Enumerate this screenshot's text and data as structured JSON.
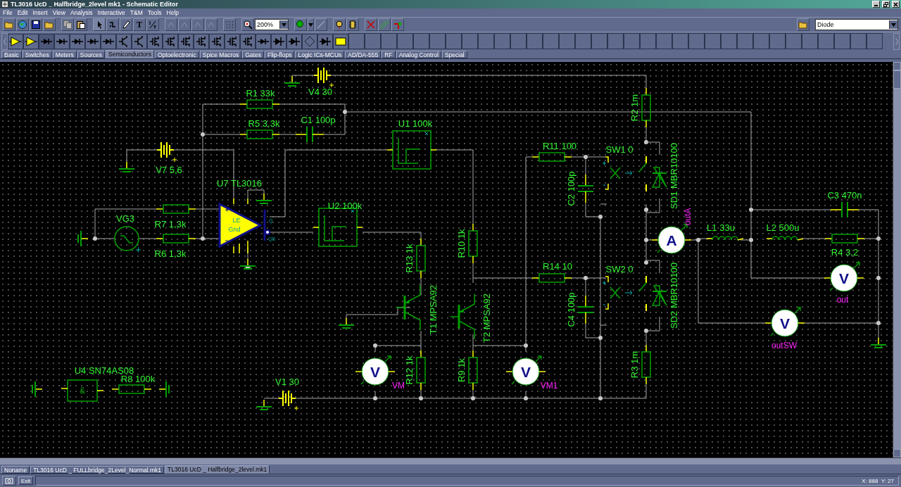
{
  "window": {
    "title": "TL3016 UcD _ Halfbridge_2level mk1 - Schematic Editor"
  },
  "menu": [
    "File",
    "Edit",
    "Insert",
    "View",
    "Analysis",
    "Interactive",
    "T&M",
    "Tools",
    "Help"
  ],
  "toolbar": {
    "text_tool": "T",
    "zoom": "200%",
    "component_select": "Diode"
  },
  "component_tabs": [
    {
      "label": "Basic",
      "selected": false
    },
    {
      "label": "Switches",
      "selected": false
    },
    {
      "label": "Meters",
      "selected": false
    },
    {
      "label": "Sources",
      "selected": false
    },
    {
      "label": "Semiconductors",
      "selected": true
    },
    {
      "label": "Optoelectronic",
      "selected": false
    },
    {
      "label": "Spice Macros",
      "selected": false
    },
    {
      "label": "Gates",
      "selected": false
    },
    {
      "label": "Flip-flops",
      "selected": false
    },
    {
      "label": "Logic ICs-MCUs",
      "selected": false
    },
    {
      "label": "AD/DA-555",
      "selected": false
    },
    {
      "label": "RF",
      "selected": false
    },
    {
      "label": "Analog Control",
      "selected": false
    },
    {
      "label": "Special",
      "selected": false
    }
  ],
  "schematic": {
    "parts": [
      {
        "kind": "resistor",
        "label": "R1 33k"
      },
      {
        "kind": "resistor",
        "label": "R5 3,3k"
      },
      {
        "kind": "capacitor",
        "label": "C1 100p"
      },
      {
        "kind": "battery",
        "label": "V4 30"
      },
      {
        "kind": "battery",
        "label": "V7 5,6"
      },
      {
        "kind": "source",
        "label": "VG3"
      },
      {
        "kind": "resistor",
        "label": "R7 1,3k"
      },
      {
        "kind": "resistor",
        "label": "R6 1,3k"
      },
      {
        "kind": "opamp",
        "label": "U7 TL3016",
        "pins": [
          "LE",
          "Gnd",
          "Q",
          "QB"
        ]
      },
      {
        "kind": "block",
        "label": "U1 100k"
      },
      {
        "kind": "block",
        "label": "U2 100k"
      },
      {
        "kind": "resistor",
        "label": "R13 1k"
      },
      {
        "kind": "resistor",
        "label": "R10 1k"
      },
      {
        "kind": "transistor",
        "label": "T1 MPSA92"
      },
      {
        "kind": "transistor",
        "label": "T2 MPSA92"
      },
      {
        "kind": "resistor",
        "label": "R12 1k"
      },
      {
        "kind": "resistor",
        "label": "R9 1k"
      },
      {
        "kind": "battery",
        "label": "V1 30"
      },
      {
        "kind": "voltmeter",
        "symbol": "V",
        "label": "VM"
      },
      {
        "kind": "resistor",
        "label": "R11 100"
      },
      {
        "kind": "capacitor",
        "label": "C2 100p"
      },
      {
        "kind": "switch",
        "label": "SW1 0"
      },
      {
        "kind": "diode",
        "label": "SD1 MBR10100"
      },
      {
        "kind": "resistor",
        "label": "R2 1m"
      },
      {
        "kind": "resistor",
        "label": "R14 10"
      },
      {
        "kind": "capacitor",
        "label": "C4 100p"
      },
      {
        "kind": "switch",
        "label": "SW2 0"
      },
      {
        "kind": "diode",
        "label": "SD2 MBR10100"
      },
      {
        "kind": "resistor",
        "label": "R3 1m"
      },
      {
        "kind": "ammeter",
        "symbol": "A",
        "label": "outA"
      },
      {
        "kind": "inductor",
        "label": "L1 33u"
      },
      {
        "kind": "inductor",
        "label": "L2 500u"
      },
      {
        "kind": "capacitor",
        "label": "C3 470n"
      },
      {
        "kind": "resistor",
        "label": "R4 3,2"
      },
      {
        "kind": "voltmeter",
        "symbol": "V",
        "label": "out"
      },
      {
        "kind": "voltmeter",
        "symbol": "V",
        "label": "outSW"
      },
      {
        "kind": "and_gate",
        "symbol": "&",
        "label": "U4 SN74AS08"
      },
      {
        "kind": "resistor",
        "label": "R8 100k"
      },
      {
        "kind": "voltmeter",
        "symbol": "V",
        "label": "VM1"
      }
    ]
  },
  "document_tabs": [
    {
      "label": "Noname",
      "selected": false
    },
    {
      "label": "TL3016 UcD _ FULLbridge_2Level_Normal.mk1",
      "selected": false
    },
    {
      "label": "TL3016 UcD _ Halfbridge_2level.mk1",
      "selected": true
    }
  ],
  "status_bar": {
    "button": "Exit",
    "coordinates": "X: 888  Y: 27"
  }
}
